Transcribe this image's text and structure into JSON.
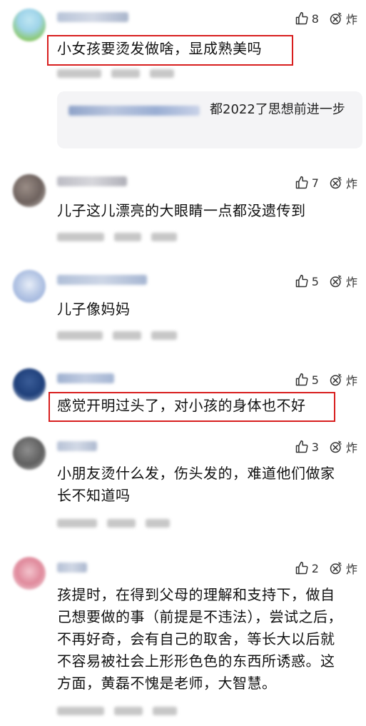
{
  "icons": {
    "like": "thumbs-up-icon",
    "bomb": "bomb-icon"
  },
  "bomb_label": "炸",
  "comments": [
    {
      "likes": "8",
      "text": "小女孩要烫发做啥，显成熟美吗",
      "reply": {
        "text": "都2022了思想前进一步"
      }
    },
    {
      "likes": "7",
      "text": "儿子这儿漂亮的大眼睛一点都没遗传到"
    },
    {
      "likes": "5",
      "text": "儿子像妈妈"
    },
    {
      "likes": "5",
      "text": "感觉开明过头了，对小孩的身体也不好"
    },
    {
      "likes": "3",
      "text": "小朋友烫什么发，伤头发的，难道他们做家长不知道吗"
    },
    {
      "likes": "2",
      "text": "孩提时，在得到父母的理解和支持下，做自己想要做的事（前提是不违法），尝试之后，不再好奇，会有自己的取舍，等长大以后就不容易被社会上形形色色的东西所诱惑。这方面，黄磊不愧是老师，大智慧。"
    }
  ],
  "highlight_color": "#d81e1e"
}
